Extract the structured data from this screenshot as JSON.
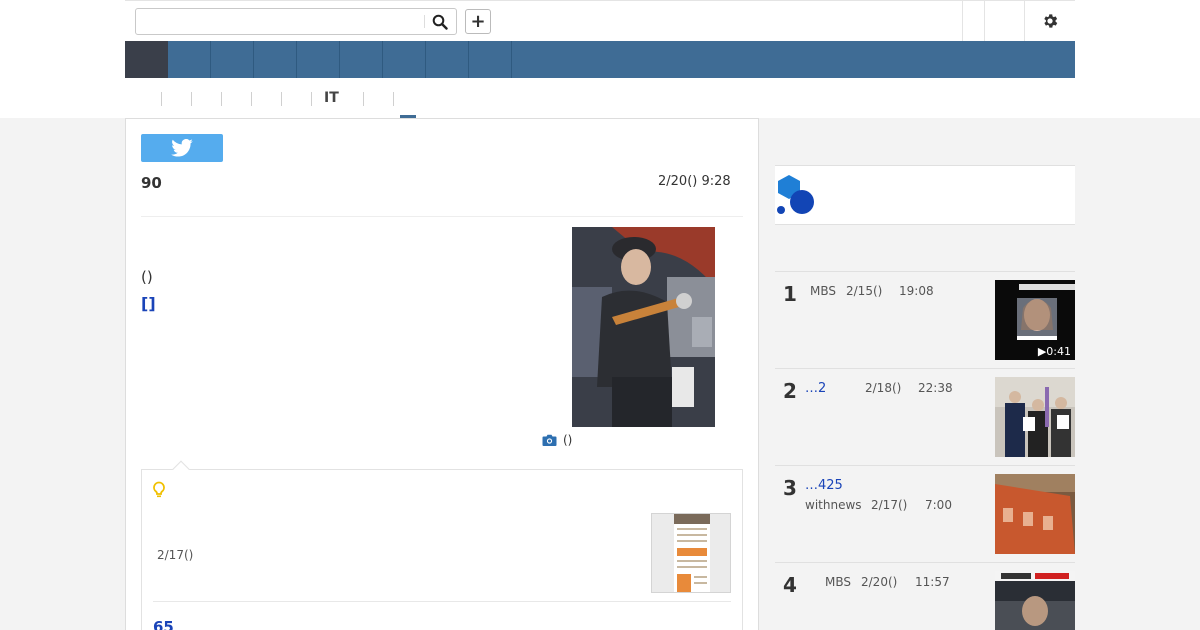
{
  "search": {
    "placeholder": "",
    "value": ""
  },
  "toolbar": {
    "add_label": "+"
  },
  "subnav": {
    "it_label": "IT"
  },
  "article": {
    "number": "90",
    "date": "2/20() 9:28",
    "paren_text": "()",
    "bracket_link": "[]",
    "photo_caption": "()"
  },
  "related": {
    "date": "2/17()",
    "count_link": "65"
  },
  "ranking": [
    {
      "rank": "1",
      "title": "",
      "source": "MBS",
      "date": "2/15()",
      "time": "19:08",
      "duration": "▶0:41"
    },
    {
      "rank": "2",
      "title": "…2",
      "source": "",
      "date": "2/18()",
      "time": "22:38",
      "duration": ""
    },
    {
      "rank": "3",
      "title": "…425",
      "source": "withnews",
      "date": "2/17()",
      "time": "7:00",
      "duration": ""
    },
    {
      "rank": "4",
      "title": "",
      "source": "MBS",
      "date": "2/20()",
      "time": "11:57",
      "duration": ""
    }
  ],
  "colors": {
    "nav_blue": "#3f6c95",
    "twitter_blue": "#55acee",
    "link_blue": "#1a44b8",
    "bulb_yellow": "#f0c000"
  },
  "icons": [
    "search-icon",
    "gear-icon",
    "twitter-icon",
    "camera-icon",
    "lightbulb-icon",
    "play-icon"
  ]
}
